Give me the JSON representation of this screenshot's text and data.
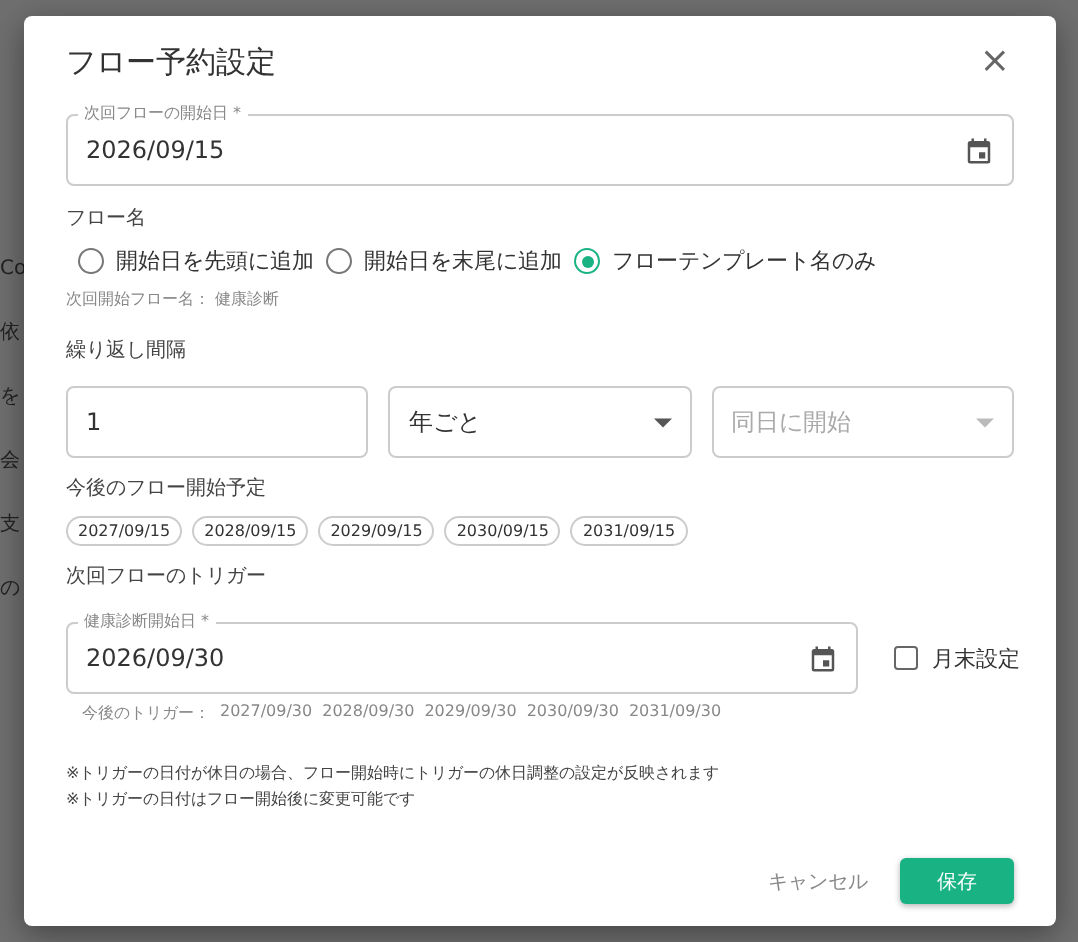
{
  "backdrop": {
    "items": [
      "Co",
      "依",
      "を",
      "会",
      "支",
      "の"
    ]
  },
  "dialog": {
    "title": "フロー予約設定",
    "close": "×",
    "start_date": {
      "label": "次回フローの開始日 *",
      "value": "2026/09/15"
    },
    "flow_name": {
      "label": "フロー名",
      "options": [
        {
          "label": "開始日を先頭に追加",
          "selected": false
        },
        {
          "label": "開始日を末尾に追加",
          "selected": false
        },
        {
          "label": "フローテンプレート名のみ",
          "selected": true
        }
      ],
      "hint": "次回開始フロー名： 健康診断"
    },
    "interval": {
      "label": "繰り返し間隔",
      "fields": [
        {
          "kind": "input",
          "value": "1",
          "disabled": false
        },
        {
          "kind": "select",
          "value": "年ごと",
          "disabled": false
        },
        {
          "kind": "select",
          "value": "同日に開始",
          "disabled": true
        }
      ]
    },
    "upcoming": {
      "label": "今後のフロー開始予定",
      "chips": [
        "2027/09/15",
        "2028/09/15",
        "2029/09/15",
        "2030/09/15",
        "2031/09/15"
      ]
    },
    "trigger": {
      "label": "次回フローのトリガー",
      "field": {
        "label": "健康診断開始日 *",
        "value": "2026/09/30"
      },
      "month_end": {
        "label": "月末設定",
        "checked": false
      },
      "hint_label": "今後のトリガー：",
      "dates": [
        "2027/09/30",
        "2028/09/30",
        "2029/09/30",
        "2030/09/30",
        "2031/09/30"
      ]
    },
    "notes": [
      "※トリガーの日付が休日の場合、フロー開始時にトリガーの休日調整の設定が反映されます",
      "※トリガーの日付はフロー開始後に変更可能です"
    ],
    "buttons": {
      "cancel": "キャンセル",
      "save": "保存"
    }
  }
}
